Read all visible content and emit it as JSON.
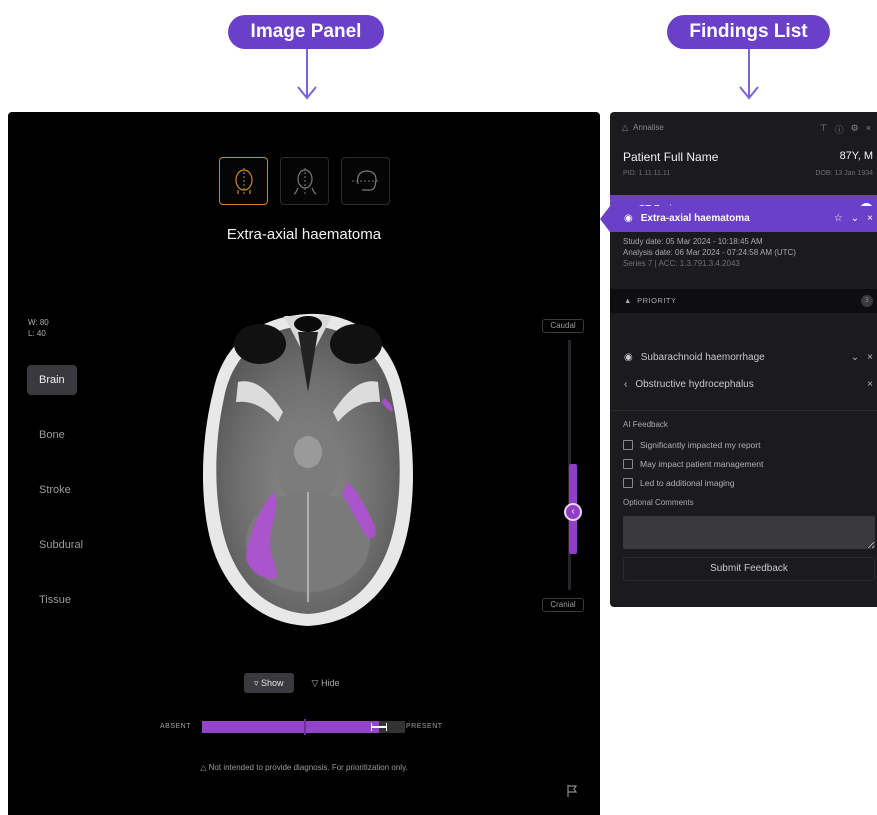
{
  "callouts": {
    "image_panel": "Image Panel",
    "findings_list": "Findings List"
  },
  "image_panel": {
    "finding_title": "Extra-axial haematoma",
    "window": {
      "w": "W: 80",
      "l": "L: 40"
    },
    "presets": [
      "Brain",
      "Bone",
      "Stroke",
      "Subdural",
      "Tissue"
    ],
    "active_preset": "Brain",
    "slice_labels": {
      "top": "Caudal",
      "bottom": "Cranial"
    },
    "show_label": "Show",
    "hide_label": "Hide",
    "confidence": {
      "absent_label": "ABSENT",
      "present_label": "PRESENT",
      "value": 0.87,
      "threshold": 0.5
    },
    "disclaimer": "Not intended to provide diagnosis. For prioritization only."
  },
  "findings": {
    "app_name": "Annalise",
    "patient": {
      "name": "Patient Full Name",
      "age_sex": "87Y, M",
      "pid": "PID: 1.11.11.11",
      "dob": "DOB: 13 Jan 1934"
    },
    "study": {
      "title": "CT Brain",
      "count": "3",
      "study_date": "Study date: 05 Mar 2024 - 10:18:45 AM",
      "analysis_date": "Analysis date: 06 Mar 2024 - 07:24:58 AM (UTC)",
      "series": "Series 7",
      "acc": "ACC: 1.3.791.3.4.2043"
    },
    "priority": {
      "label": "PRIORITY",
      "count": "3"
    },
    "items": [
      {
        "label": "Extra-axial haematoma"
      },
      {
        "label": "Subarachnoid haemorrhage"
      },
      {
        "label": "Obstructive hydrocephalus"
      }
    ],
    "feedback": {
      "title": "AI Feedback",
      "options": [
        "Significantly impacted my report",
        "May impact patient management",
        "Led to additional imaging"
      ],
      "comments_label": "Optional Comments",
      "comments_value": "",
      "submit_label": "Submit Feedback"
    }
  }
}
